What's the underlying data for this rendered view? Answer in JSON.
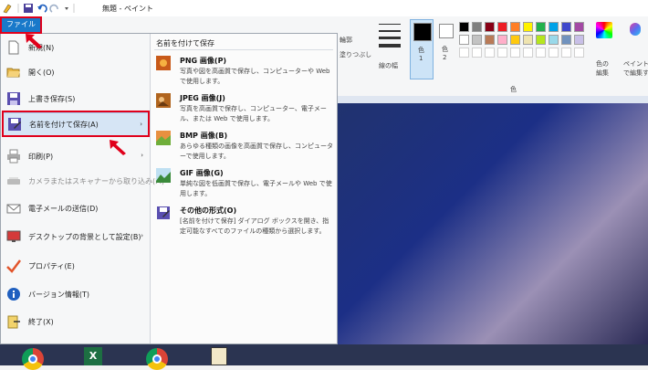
{
  "window": {
    "title": "無題 - ペイント"
  },
  "file_tab": {
    "label": "ファイル"
  },
  "ribbon": {
    "outline_label": "輪郭",
    "fill_label": "塗りつぶし",
    "size_label": "線の幅",
    "color1_label": "色\n1",
    "color1_main": "色",
    "color1_num": "1",
    "color2_main": "色",
    "color2_num": "2",
    "edit_colors_label": "色の\n編集",
    "edit_colors_l1": "色の",
    "edit_colors_l2": "編集",
    "paint3d_l1": "ペイント",
    "paint3d_l2": "で編集す",
    "colors_group_label": "色",
    "palette": [
      "#000000",
      "#7f7f7f",
      "#880015",
      "#ed1c24",
      "#ff7f27",
      "#fff200",
      "#22b14c",
      "#00a2e8",
      "#3f48cc",
      "#a349a4",
      "#ffffff",
      "#c3c3c3",
      "#b97a57",
      "#ffaec9",
      "#ffc90e",
      "#efe4b0",
      "#b5e61d",
      "#99d9ea",
      "#7092be",
      "#c8bfe7"
    ]
  },
  "menu": {
    "left_items": [
      {
        "label": "新規(N)",
        "icon": "new-file-icon",
        "disabled": false
      },
      {
        "label": "開く(O)",
        "icon": "open-folder-icon",
        "disabled": false
      },
      {
        "label": "上書き保存(S)",
        "icon": "save-icon",
        "disabled": false
      },
      {
        "label": "名前を付けて保存(A)",
        "icon": "save-as-icon",
        "disabled": false
      },
      {
        "label": "印刷(P)",
        "icon": "printer-icon",
        "disabled": false
      },
      {
        "label": "カメラまたはスキャナーから取り込み(M)",
        "icon": "scanner-icon",
        "disabled": true
      },
      {
        "label": "電子メールの送信(D)",
        "icon": "email-icon",
        "disabled": false
      },
      {
        "label": "デスクトップの背景として設定(B)",
        "icon": "desktop-background-icon",
        "disabled": false
      },
      {
        "label": "プロパティ(E)",
        "icon": "checkmark-icon",
        "disabled": false
      },
      {
        "label": "バージョン情報(T)",
        "icon": "info-icon",
        "disabled": false
      },
      {
        "label": "終了(X)",
        "icon": "exit-icon",
        "disabled": false
      }
    ],
    "submenu": {
      "heading": "名前を付けて保存",
      "items": [
        {
          "title": "PNG 画像(P)",
          "desc": "写真や図を高画質で保存し、コンピューターや Web で使用します。",
          "icon": "png-image-icon"
        },
        {
          "title": "JPEG 画像(J)",
          "desc": "写真を高画質で保存し、コンピューター、電子メール、または Web で使用します。",
          "icon": "jpeg-image-icon"
        },
        {
          "title": "BMP 画像(B)",
          "desc": "あらゆる種類の画像を高画質で保存し、コンピューターで使用します。",
          "icon": "bmp-image-icon"
        },
        {
          "title": "GIF 画像(G)",
          "desc": "単純な図を低画質で保存し、電子メールや Web で使用します。",
          "icon": "gif-image-icon"
        },
        {
          "title": "その他の形式(O)",
          "desc": "[名前を付けて保存] ダイアログ ボックスを開き、指定可能なすべてのファイルの種類から選択します。",
          "icon": "other-formats-icon"
        }
      ]
    }
  }
}
